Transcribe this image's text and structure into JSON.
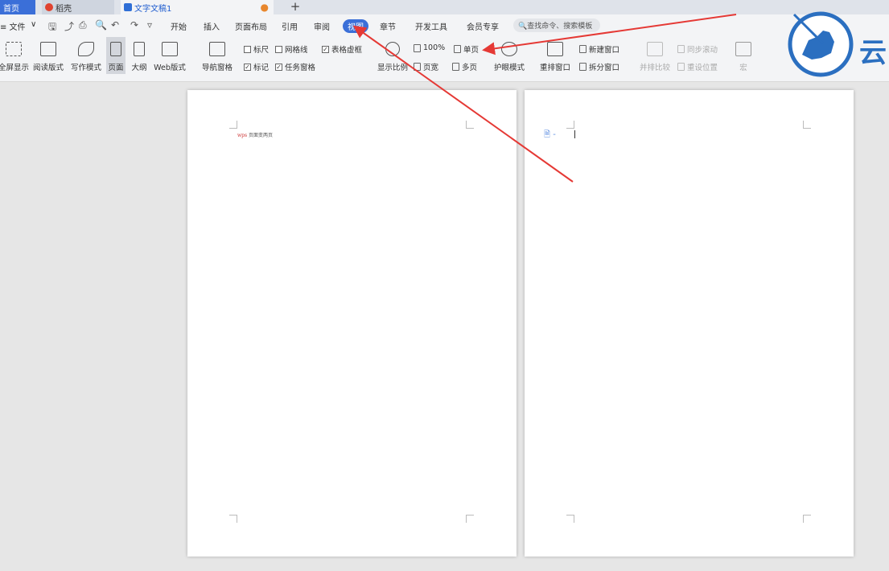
{
  "tabs": {
    "home": "首页",
    "daoke": "稻壳",
    "doc": "文字文稿1",
    "new_tab": "+"
  },
  "menu": {
    "file": "≡ 文件",
    "items": [
      "开始",
      "插入",
      "页面布局",
      "引用",
      "审阅",
      "视图",
      "章节",
      "开发工具",
      "会员专享"
    ],
    "active": "视图",
    "search_placeholder": "查找命令、搜索模板"
  },
  "ribbon": {
    "fullscreen": "全屏显示",
    "reading": "阅读版式",
    "writing": "写作模式",
    "page": "页面",
    "outline": "大纲",
    "web": "Web版式",
    "nav_pane": "导航窗格",
    "ruler": "标尺",
    "gridlines": "网格线",
    "table_gridlines": "表格虚框",
    "marks": "标记",
    "task_pane": "任务窗格",
    "zoom": "显示比例",
    "zoom_100": "100%",
    "single_page": "单页",
    "page_width": "页宽",
    "multi_page": "多页",
    "eye_care": "护眼模式",
    "rearrange": "重排窗口",
    "new_window": "新建窗口",
    "split_window": "拆分窗口",
    "side_by_side": "并排比较",
    "sync_scroll": "同步滚动",
    "reset_position": "重设位置",
    "macro": "宏"
  },
  "checkboxes": {
    "ruler": false,
    "gridlines": false,
    "table_gridlines": true,
    "marks": true,
    "task_pane": true
  },
  "document": {
    "page1_header_text": "页面变两页"
  },
  "logo": {
    "text": "云"
  },
  "colors": {
    "accent": "#3b6fd8",
    "annotation_arrow": "#e53935"
  }
}
